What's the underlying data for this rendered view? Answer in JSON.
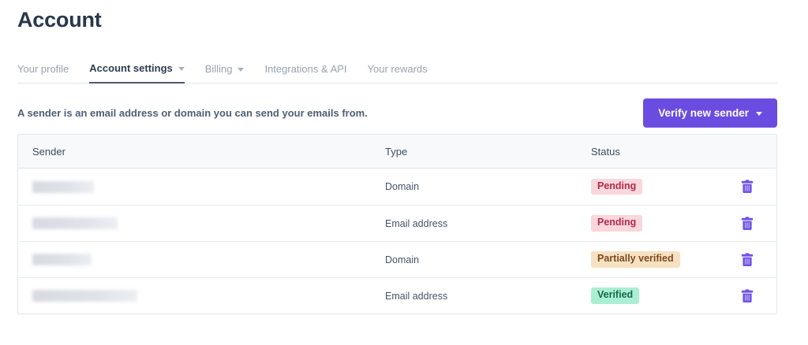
{
  "page": {
    "title": "Account"
  },
  "tabs": [
    {
      "label": "Your profile",
      "active": false,
      "has_dropdown": false
    },
    {
      "label": "Account settings",
      "active": true,
      "has_dropdown": true
    },
    {
      "label": "Billing",
      "active": false,
      "has_dropdown": true
    },
    {
      "label": "Integrations & API",
      "active": false,
      "has_dropdown": false
    },
    {
      "label": "Your rewards",
      "active": false,
      "has_dropdown": false
    }
  ],
  "sender_section": {
    "description": "A sender is an email address or domain you can send your emails from.",
    "verify_button_label": "Verify new sender"
  },
  "table": {
    "headers": {
      "sender": "Sender",
      "type": "Type",
      "status": "Status"
    },
    "rows": [
      {
        "sender": "",
        "type": "Domain",
        "status": "Pending"
      },
      {
        "sender": "",
        "type": "Email address",
        "status": "Pending"
      },
      {
        "sender": "",
        "type": "Domain",
        "status": "Partially verified"
      },
      {
        "sender": "",
        "type": "Email address",
        "status": "Verified"
      }
    ]
  },
  "icons": {
    "delete": "trash-icon",
    "dropdown": "chevron-down-icon"
  },
  "colors": {
    "accent_purple": "#6b4ce1",
    "trash_purple": "#7152e2",
    "status_pending_bg": "#f9d7da",
    "status_pending_text": "#b02a50",
    "status_partial_bg": "#f6e1c2",
    "status_partial_text": "#7c4a1d",
    "status_verified_bg": "#abefd2",
    "status_verified_text": "#16684c",
    "header_bg": "#f7f9fb",
    "table_border": "#e2e7ed"
  }
}
